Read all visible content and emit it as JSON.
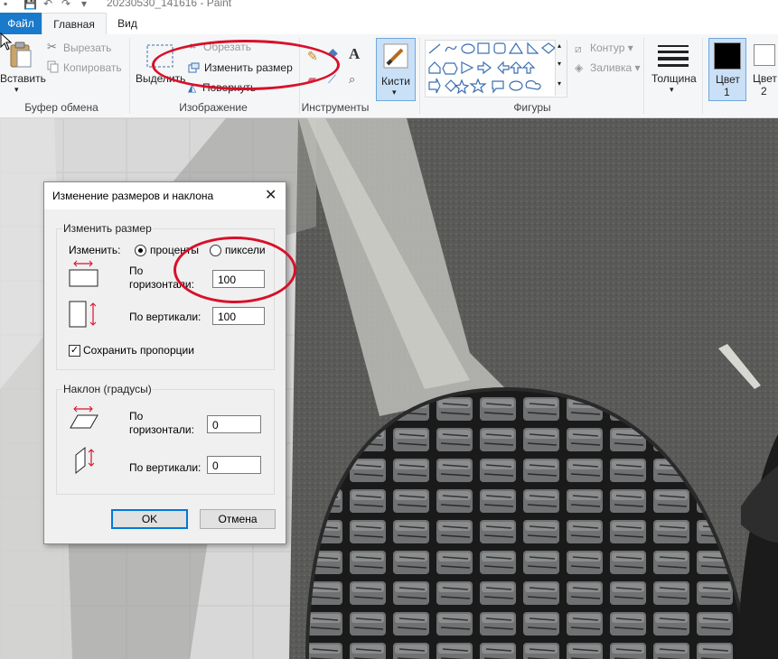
{
  "window": {
    "title": "20230530_141616 - Paint"
  },
  "tabs": {
    "file": "Файл",
    "home": "Главная",
    "view": "Вид"
  },
  "clipboard": {
    "paste": "Вставить",
    "cut": "Вырезать",
    "copy": "Копировать",
    "group_label": "Буфер обмена"
  },
  "image": {
    "select": "Выделить",
    "crop": "Обрезать",
    "resize": "Изменить размер",
    "rotate": "Повернуть",
    "group_label": "Изображение"
  },
  "tools": {
    "group_label": "Инструменты",
    "text_glyph": "A"
  },
  "brushes": {
    "label": "Кисти"
  },
  "shapes": {
    "outline": "Контур",
    "fill": "Заливка",
    "group_label": "Фигуры"
  },
  "size": {
    "label": "Толщина"
  },
  "colors": {
    "color1": "Цвет",
    "color1_num": "1",
    "color2": "Цвет",
    "color2_num": "2",
    "color1_value": "#000000",
    "color2_value": "#ffffff"
  },
  "dialog": {
    "title": "Изменение размеров и наклона",
    "close": "✕",
    "resize": {
      "legend": "Изменить размер",
      "by_label": "Изменить:",
      "percent": "проценты",
      "pixels": "пиксели",
      "horizontal_label_1": "По",
      "horizontal_label_2": "горизонтали:",
      "horizontal_value": "100",
      "vertical_label": "По вертикали:",
      "vertical_value": "100",
      "keep_ratio": "Сохранить пропорции",
      "keep_ratio_checked": "✓"
    },
    "skew": {
      "legend": "Наклон (градусы)",
      "horizontal_label_1": "По",
      "horizontal_label_2": "горизонтали:",
      "horizontal_value": "0",
      "vertical_label": "По вертикали:",
      "vertical_value": "0"
    },
    "ok": "OK",
    "cancel": "Отмена"
  },
  "accent_colors": {
    "annotation": "#d8102a",
    "file_tab": "#1979ca",
    "selection": "#0078d7"
  }
}
